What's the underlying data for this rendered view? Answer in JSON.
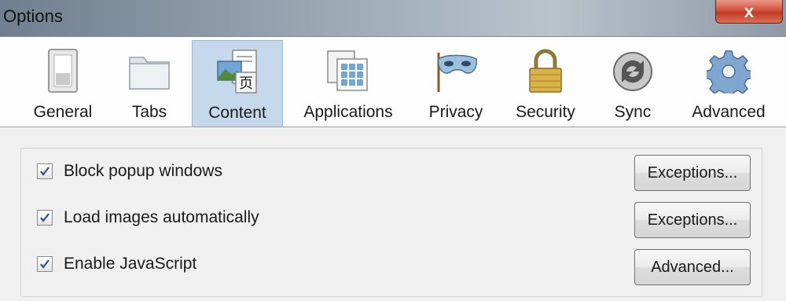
{
  "window": {
    "title": "Options",
    "close_glyph": "x"
  },
  "toolbar": {
    "tabs": [
      {
        "label": "General",
        "icon": "window-switch-icon"
      },
      {
        "label": "Tabs",
        "icon": "tabs-folder-icon"
      },
      {
        "label": "Content",
        "icon": "content-page-icon",
        "selected": true
      },
      {
        "label": "Applications",
        "icon": "applications-icon"
      },
      {
        "label": "Privacy",
        "icon": "mask-icon"
      },
      {
        "label": "Security",
        "icon": "padlock-icon"
      },
      {
        "label": "Sync",
        "icon": "sync-icon"
      },
      {
        "label": "Advanced",
        "icon": "gear-icon"
      }
    ]
  },
  "content": {
    "options": [
      {
        "label": "Block popup windows",
        "checked": true,
        "button": "Exceptions..."
      },
      {
        "label": "Load images automatically",
        "checked": true,
        "button": "Exceptions..."
      },
      {
        "label": "Enable JavaScript",
        "checked": true,
        "button": "Advanced..."
      }
    ]
  },
  "colors": {
    "selected_tab": "#c6d8ec",
    "close_button": "#d5503a",
    "checkmark": "#2a4f8f"
  }
}
